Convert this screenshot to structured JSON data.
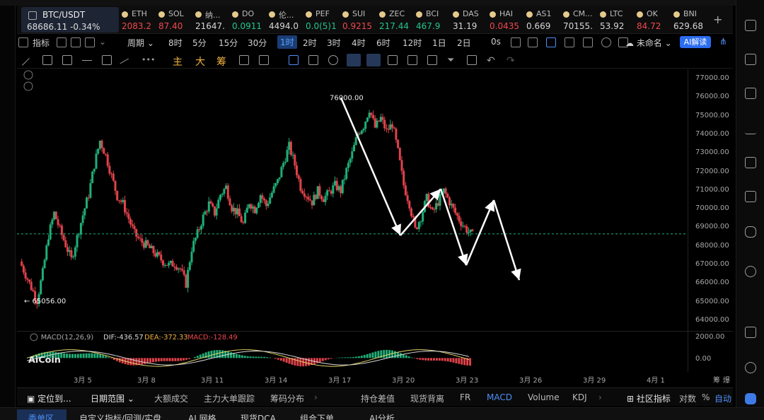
{
  "ticker": {
    "active": {
      "symbol": "BTC/USDT",
      "price": "68686.11",
      "change": "-0.34%"
    },
    "items": [
      {
        "symbol": "ETH",
        "price": "2083.2",
        "dir": "dn"
      },
      {
        "symbol": "SOL",
        "price": "87.40",
        "dir": "dn"
      },
      {
        "symbol": "纳...",
        "price": "21647.",
        "dir": "nt"
      },
      {
        "symbol": "DO",
        "price": "0.0911",
        "dir": "up"
      },
      {
        "symbol": "伦...",
        "price": "4494.0",
        "dir": "nt"
      },
      {
        "symbol": "PEF",
        "price": "0.0(5)1",
        "dir": "up"
      },
      {
        "symbol": "SUI",
        "price": "0.9215",
        "dir": "dn"
      },
      {
        "symbol": "ZEC",
        "price": "217.44",
        "dir": "up"
      },
      {
        "symbol": "BCI",
        "price": "467.9",
        "dir": "up"
      },
      {
        "symbol": "DAS",
        "price": "31.19",
        "dir": "nt"
      },
      {
        "symbol": "HAI",
        "price": "0.0435",
        "dir": "dn"
      },
      {
        "symbol": "AS1",
        "price": "0.669",
        "dir": "nt"
      },
      {
        "symbol": "CM...",
        "price": "70155.",
        "dir": "nt"
      },
      {
        "symbol": "LTC",
        "price": "53.92",
        "dir": "nt"
      },
      {
        "symbol": "OK",
        "price": "84.72",
        "dir": "dn"
      },
      {
        "symbol": "BNI",
        "price": "629.68",
        "dir": "nt"
      }
    ],
    "add": "+"
  },
  "toolbar": {
    "indicator": "指标",
    "period": "周期",
    "intervals": [
      "8时",
      "5分",
      "15分",
      "30分",
      "1时",
      "2时",
      "3时",
      "4时",
      "6时",
      "12时",
      "1日",
      "2日"
    ],
    "selected_interval": "1时",
    "countdown": "0s",
    "layout": "未命名",
    "ai": "AI解读"
  },
  "drawbar": {
    "chars": [
      "主",
      "大",
      "筹"
    ]
  },
  "chart_data": {
    "type": "candlestick",
    "symbol": "BTC/USDT",
    "interval": "1时",
    "ylim": [
      64000,
      77000
    ],
    "yticks": [
      77000,
      76000,
      75000,
      74000,
      73000,
      72000,
      71000,
      70000,
      69000,
      68000,
      67000,
      66000,
      65000,
      64000
    ],
    "ytick_labels": [
      "77000.00",
      "76000.00",
      "75000.00",
      "74000.00",
      "73000.00",
      "72000.00",
      "71000.00",
      "70000.00",
      "69000.00",
      "68000.00",
      "67000.00",
      "66000.00",
      "65000.00",
      "64000.00"
    ],
    "xticks": [
      "3月 5",
      "3月 8",
      "3月 11",
      "3月 14",
      "3月 17",
      "3月 20",
      "3月 23",
      "3月 26",
      "3月 29",
      "4月 1"
    ],
    "price_path": [
      [
        0,
        67200
      ],
      [
        2,
        66500
      ],
      [
        4,
        65800
      ],
      [
        6,
        65100
      ],
      [
        8,
        66600
      ],
      [
        10,
        68600
      ],
      [
        12,
        69800
      ],
      [
        14,
        68900
      ],
      [
        16,
        68100
      ],
      [
        18,
        67300
      ],
      [
        20,
        68500
      ],
      [
        22,
        69700
      ],
      [
        24,
        70800
      ],
      [
        26,
        72400
      ],
      [
        28,
        73700
      ],
      [
        30,
        72900
      ],
      [
        32,
        71800
      ],
      [
        34,
        70700
      ],
      [
        36,
        70300
      ],
      [
        38,
        69500
      ],
      [
        40,
        68700
      ],
      [
        42,
        68300
      ],
      [
        44,
        68100
      ],
      [
        46,
        67800
      ],
      [
        48,
        67500
      ],
      [
        50,
        67200
      ],
      [
        52,
        67000
      ],
      [
        54,
        67100
      ],
      [
        56,
        66800
      ],
      [
        58,
        66000
      ],
      [
        60,
        67900
      ],
      [
        62,
        68700
      ],
      [
        64,
        69600
      ],
      [
        66,
        70300
      ],
      [
        68,
        69800
      ],
      [
        70,
        70800
      ],
      [
        72,
        71200
      ],
      [
        74,
        70100
      ],
      [
        76,
        69800
      ],
      [
        78,
        69200
      ],
      [
        80,
        70400
      ],
      [
        82,
        70000
      ],
      [
        84,
        70800
      ],
      [
        86,
        70200
      ],
      [
        88,
        70900
      ],
      [
        90,
        71500
      ],
      [
        92,
        72500
      ],
      [
        94,
        73400
      ],
      [
        96,
        72400
      ],
      [
        98,
        71200
      ],
      [
        100,
        70800
      ],
      [
        102,
        70400
      ],
      [
        104,
        71000
      ],
      [
        106,
        70600
      ],
      [
        108,
        70900
      ],
      [
        110,
        71300
      ],
      [
        112,
        71000
      ],
      [
        114,
        72100
      ],
      [
        116,
        73000
      ],
      [
        118,
        74100
      ],
      [
        120,
        74500
      ],
      [
        122,
        75400
      ],
      [
        124,
        74400
      ],
      [
        126,
        74900
      ],
      [
        128,
        74200
      ],
      [
        130,
        74600
      ],
      [
        132,
        73100
      ],
      [
        134,
        71300
      ],
      [
        136,
        70300
      ],
      [
        138,
        68900
      ],
      [
        140,
        69600
      ],
      [
        142,
        70600
      ],
      [
        144,
        69800
      ],
      [
        146,
        70400
      ],
      [
        148,
        71000
      ],
      [
        150,
        70400
      ],
      [
        152,
        69800
      ],
      [
        154,
        69300
      ],
      [
        156,
        68900
      ],
      [
        158,
        68600
      ]
    ],
    "last_price": 68686.11,
    "annotations": [
      {
        "text": "76000.00",
        "value": 76000
      },
      {
        "text": "← 65056.00",
        "value": 65056
      }
    ],
    "drawn_path": [
      {
        "t": "3月 17",
        "value": 76000
      },
      {
        "t": "3月 20",
        "value": 68600
      },
      {
        "t": "3月 21",
        "value": 71100
      },
      {
        "t": "3月 22",
        "value": 67000
      },
      {
        "t": "3月 24",
        "value": 70500
      },
      {
        "t": "3月 25",
        "value": 66200
      }
    ],
    "macd": {
      "label": "MACD(12,26,9)",
      "dif_label": "DIF:-436.57",
      "dea_label": "DEA:-372.33",
      "macd_label": "MACD:-128.49",
      "yticks": [
        "2000.00",
        "0.00"
      ]
    }
  },
  "watermark": "AiCoin",
  "xaxis_extra": [
    "筹",
    "爆"
  ],
  "bottom_tabs": {
    "left": [
      "定位到...",
      "日期范围"
    ],
    "items": [
      "大额成交",
      "主力大单跟踪",
      "筹码分布",
      "持仓差值",
      "现货背离",
      "FR",
      "MACD",
      "Volume",
      "KDJ"
    ],
    "active": "MACD",
    "right": [
      "社区指标",
      "对数",
      "%",
      "自动"
    ]
  },
  "footer": {
    "items": [
      "委单区",
      "自定义指标/回测/实盘",
      "AI 网格",
      "现货DCA",
      "组合下单",
      "AI分析"
    ]
  }
}
